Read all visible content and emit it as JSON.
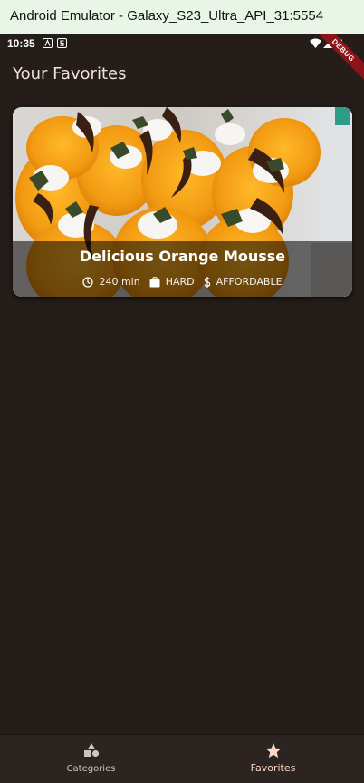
{
  "window": {
    "title": "Android Emulator - Galaxy_S23_Ultra_API_31:5554"
  },
  "status_bar": {
    "time": "10:35",
    "debug_label": "DEBUG"
  },
  "app_bar": {
    "title": "Your Favorites"
  },
  "favorites": [
    {
      "title": "Delicious Orange Mousse",
      "duration": "240 min",
      "complexity": "HARD",
      "affordability": "AFFORDABLE"
    }
  ],
  "bottom_nav": {
    "items": [
      {
        "label": "Categories",
        "icon": "category-icon",
        "selected": false
      },
      {
        "label": "Favorites",
        "icon": "star-icon",
        "selected": true
      }
    ]
  },
  "colors": {
    "background": "#241d19",
    "nav_background": "#2c2420",
    "selected": "#ffd8c5",
    "emulator_titlebar": "#e9f6e7"
  }
}
